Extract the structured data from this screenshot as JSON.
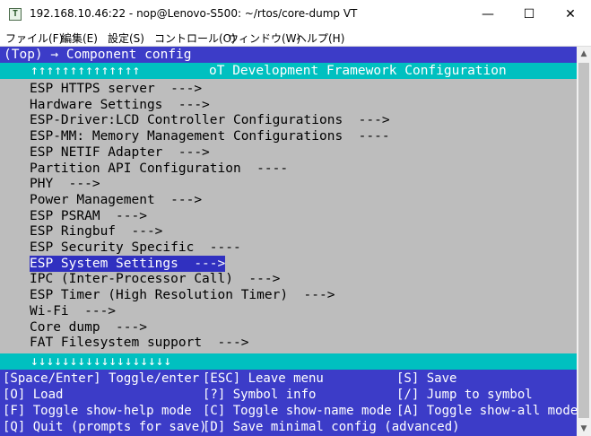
{
  "window": {
    "title": "192.168.10.46:22 - nop@Lenovo-S500: ~/rtos/core-dump VT",
    "icon_label": "T",
    "buttons": {
      "minimize": "—",
      "maximize": "☐",
      "close": "✕"
    }
  },
  "menubar": [
    "ファイル(F)",
    "編集(E)",
    "設定(S)",
    "コントロール(O)",
    "ウィンドウ(W)",
    "ヘルプ(H)"
  ],
  "terminal": {
    "breadcrumb": "(Top) → Component config",
    "header_arrows": "↑↑↑↑↑↑↑↑↑↑↑↑↑↑",
    "header_title": "oT Development Framework Configuration",
    "items": [
      "ESP HTTPS server  --->",
      "Hardware Settings  --->",
      "ESP-Driver:LCD Controller Configurations  --->",
      "ESP-MM: Memory Management Configurations  ----",
      "ESP NETIF Adapter  --->",
      "Partition API Configuration  ----",
      "PHY  --->",
      "Power Management  --->",
      "ESP PSRAM  --->",
      "ESP Ringbuf  --->",
      "ESP Security Specific  ----",
      "ESP System Settings  --->",
      "IPC (Inter-Processor Call)  --->",
      "ESP Timer (High Resolution Timer)  --->",
      "Wi-Fi  --->",
      "Core dump  --->",
      "FAT Filesystem support  --->"
    ],
    "selected_index": 11,
    "footer_arrows": "↓↓↓↓↓↓↓↓↓↓↓↓↓↓↓↓↓↓",
    "help": {
      "row1": [
        "[Space/Enter] Toggle/enter",
        "[ESC] Leave menu",
        "[S] Save"
      ],
      "row2": [
        "[O] Load",
        "[?] Symbol info",
        "[/] Jump to symbol"
      ],
      "row3": [
        "[F] Toggle show-help mode",
        "[C] Toggle show-name mode",
        "[A] Toggle show-all mode"
      ],
      "row4": [
        "[Q] Quit (prompts for save)",
        "[D] Save minimal config (advanced)"
      ]
    }
  },
  "colors": {
    "terminal_bg": "#bdbdbd",
    "bar_blue": "#3c3cc8",
    "header_cyan": "#00c0c0",
    "selected_bg": "#3030c0"
  }
}
